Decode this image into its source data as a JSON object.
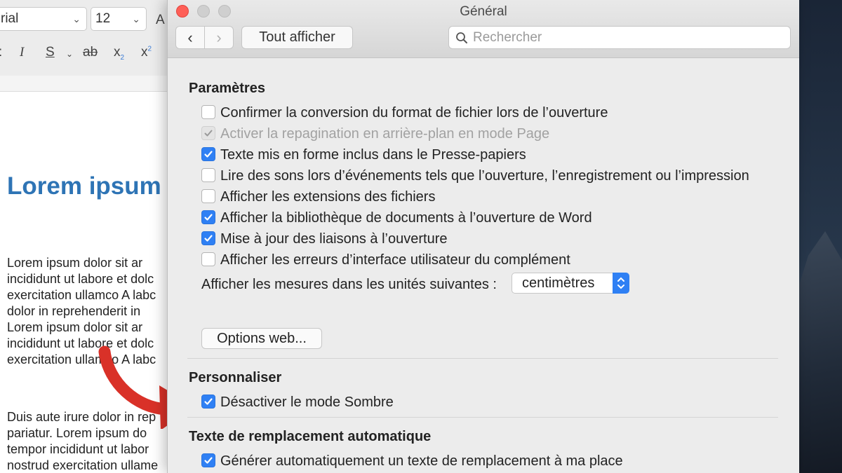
{
  "word": {
    "font_name": "rial",
    "font_size": "12",
    "format_icons": [
      "italic-icon",
      "strikethrough-icon",
      "underline-icon",
      "subscript-icon",
      "superscript-icon"
    ],
    "italic": "I",
    "underline": "S",
    "strike": "ab",
    "subscript": "x",
    "superscript": "x",
    "doc_title": "Lorem ipsum",
    "para1": "Lorem ipsum dolor sit ar\nincididunt ut labore et dolc\nexercitation ullamco A labc\ndolor in reprehenderit in\nLorem ipsum dolor sit ar\nincididunt ut labore et dolc\nexercitation ullamco A labc",
    "para2": "Duis aute irure dolor in rep\npariatur. Lorem ipsum do\ntempor incididunt ut labor\nnostrud exercitation ullame"
  },
  "window": {
    "title": "Général",
    "show_all": "Tout afficher",
    "search_placeholder": "Rechercher",
    "colors": {
      "close": "#fe5f57",
      "inactive_light": "#cfcfcf",
      "accent": "#2f80f4"
    }
  },
  "parametres": {
    "title": "Paramètres",
    "options": [
      {
        "label": "Confirmer la conversion du format de fichier lors de l’ouverture",
        "checked": false,
        "disabled": false
      },
      {
        "label": "Activer la repagination en arrière-plan en mode Page",
        "checked": true,
        "disabled": true
      },
      {
        "label": "Texte mis en forme inclus dans le Presse-papiers",
        "checked": true,
        "disabled": false
      },
      {
        "label": "Lire des sons lors d’événements tels que l’ouverture, l’enregistrement ou l’impression",
        "checked": false,
        "disabled": false
      },
      {
        "label": "Afficher les extensions des fichiers",
        "checked": false,
        "disabled": false
      },
      {
        "label": "Afficher la bibliothèque de documents à l’ouverture de Word",
        "checked": true,
        "disabled": false
      },
      {
        "label": "Mise à jour des liaisons à l’ouverture",
        "checked": true,
        "disabled": false
      },
      {
        "label": "Afficher les erreurs d’interface utilisateur du complément",
        "checked": false,
        "disabled": false
      }
    ],
    "units_label": "Afficher les mesures dans les unités suivantes :",
    "units_value": "centimètres",
    "web_options": "Options web..."
  },
  "personnaliser": {
    "title": "Personnaliser",
    "option": {
      "label": "Désactiver le mode Sombre",
      "checked": true
    }
  },
  "remplacement": {
    "title": "Texte de remplacement automatique",
    "option": {
      "label": "Générer automatiquement un texte de remplacement à ma place",
      "checked": true
    }
  }
}
